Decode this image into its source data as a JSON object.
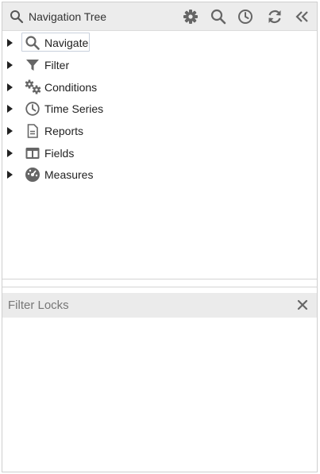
{
  "header": {
    "title": "Navigation Tree",
    "title_icon": "search-icon",
    "buttons": [
      {
        "name": "settings",
        "icon": "gear-icon"
      },
      {
        "name": "search",
        "icon": "search-icon"
      },
      {
        "name": "history",
        "icon": "clock-icon"
      },
      {
        "name": "refresh",
        "icon": "refresh-icon"
      },
      {
        "name": "collapse",
        "icon": "double-chevron-left-icon"
      }
    ]
  },
  "tree": {
    "items": [
      {
        "label": "Navigate",
        "icon": "search-icon",
        "focused": true
      },
      {
        "label": "Filter",
        "icon": "filter-icon"
      },
      {
        "label": "Conditions",
        "icon": "gears-icon"
      },
      {
        "label": "Time Series",
        "icon": "clock-icon"
      },
      {
        "label": "Reports",
        "icon": "document-icon"
      },
      {
        "label": "Fields",
        "icon": "columns-icon"
      },
      {
        "label": "Measures",
        "icon": "dashboard-icon"
      }
    ]
  },
  "filter_locks": {
    "title": "Filter Locks",
    "close_icon": "close-icon"
  },
  "colors": {
    "header_bg": "#ececec",
    "icon": "#666666",
    "locks_header_bg": "#ebebeb",
    "locks_title": "#777777"
  }
}
